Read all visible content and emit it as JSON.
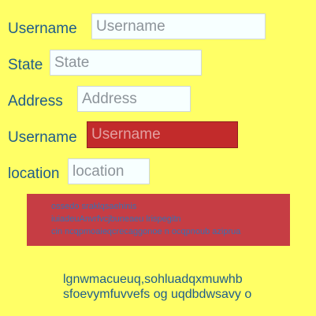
{
  "form": {
    "rows": [
      {
        "label": "Username",
        "placeholder": "Username"
      },
      {
        "label": "State",
        "placeholder": "State"
      },
      {
        "label": "Address",
        "placeholder": "Address"
      },
      {
        "label": "Username",
        "placeholder": "Username"
      },
      {
        "label": "location",
        "placeholder": "location"
      }
    ]
  },
  "error_box": {
    "lines": [
      "ossedo  sraklqsaehinis",
      "iuiadeuAnvrfvcjbuneaeu lrispegitn",
      "cin ncqpmoaieqcrecaggonoe  n  ocqpnoub  aziprua"
    ]
  },
  "body_text": {
    "lines": [
      "lgnwmacueuq,sohluadqxmuwhb",
      "sfoevymfuvvefs  og uqdbdwsavy o"
    ]
  },
  "colors": {
    "background": "#ffff66",
    "label_text": "#1f5c8a",
    "error_field": "#c22b2b",
    "error_box": "#c63d44"
  }
}
